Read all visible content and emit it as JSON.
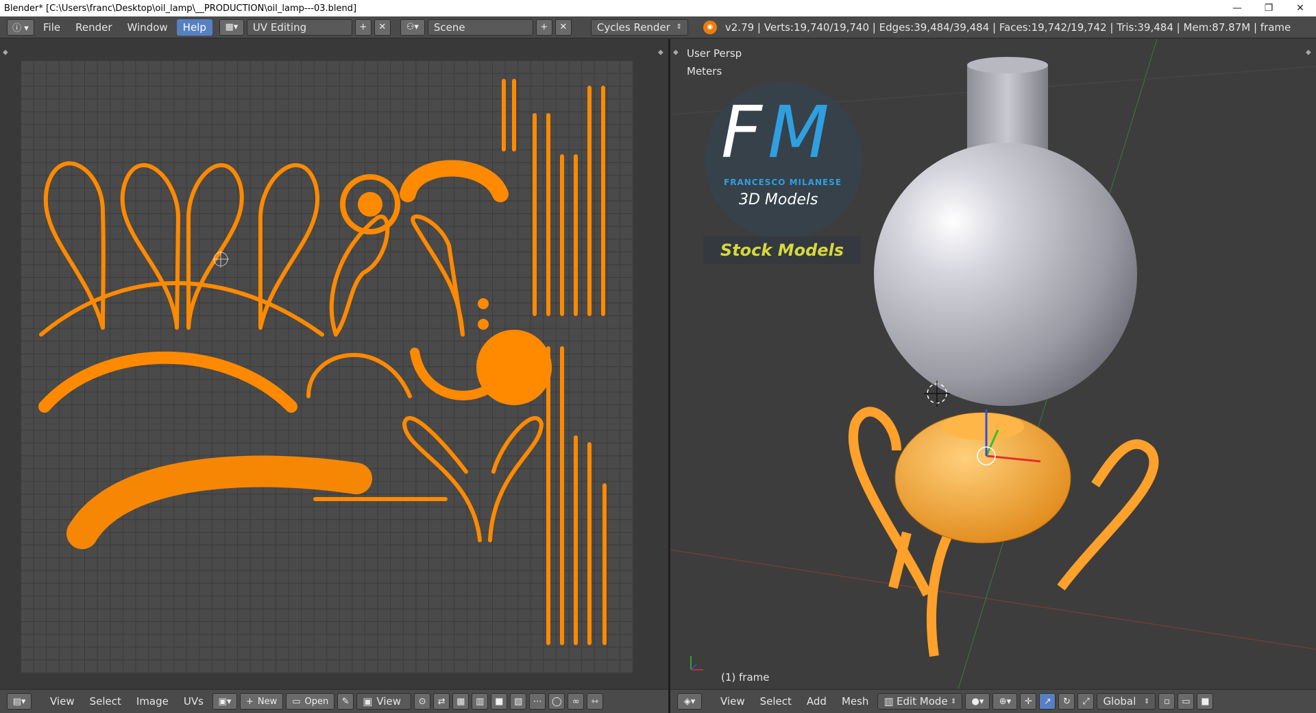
{
  "window": {
    "title": "Blender* [C:\\Users\\franc\\Desktop\\oil_lamp\\__PRODUCTION\\oil_lamp---03.blend]",
    "minimize": "—",
    "maximize": "❐",
    "close": "✕"
  },
  "topbar": {
    "menus": [
      "File",
      "Render",
      "Window",
      "Help"
    ],
    "active_menu": "Help",
    "screen_layout": "UV Editing",
    "scene": "Scene",
    "render_engine": "Cycles Render",
    "stats": "v2.79 | Verts:19,740/19,740 | Edges:39,484/39,484 | Faces:19,742/19,742 | Tris:39,484 | Mem:87.87M | frame"
  },
  "viewport": {
    "view_name": "User Persp",
    "units": "Meters",
    "object_label": "(1) frame",
    "logo": {
      "letters_f": "F",
      "letters_m": "M",
      "company": "FRANCESCO MILANESE",
      "subtitle": "3D Models",
      "badge": "Stock Models"
    }
  },
  "uv_footer": {
    "menus": [
      "View",
      "Select",
      "Image",
      "UVs"
    ],
    "new_label": "New",
    "open_label": "Open",
    "view_label": "View"
  },
  "viewport_footer": {
    "menus": [
      "View",
      "Select",
      "Add",
      "Mesh"
    ],
    "mode": "Edit Mode",
    "orientation": "Global"
  },
  "colors": {
    "uv_orange": "#ff8a00",
    "mesh_orange": "#ffa12a",
    "active_menu": "#5680c2",
    "logo_blue": "#2f9fe0",
    "badge_yellow": "#d8d83a"
  }
}
